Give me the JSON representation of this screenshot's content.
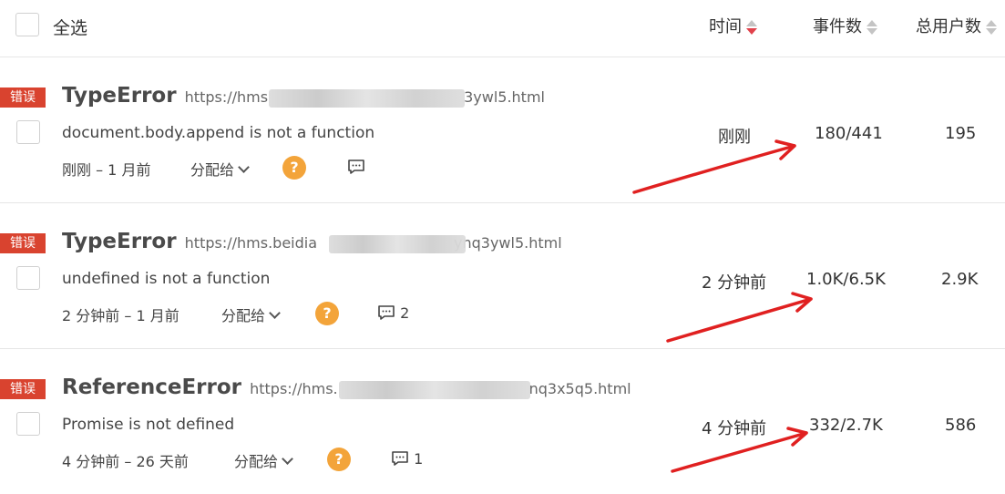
{
  "header": {
    "select_all_label": "全选",
    "col_time": "时间",
    "col_events": "事件数",
    "col_users": "总用户数"
  },
  "issues": [
    {
      "tag": "错误",
      "error_type": "TypeError",
      "url_visible_start": "https://hms",
      "url_visible_end": "3ywl5.html",
      "message": "document.body.append is not a function",
      "first_seen_range": "刚刚 – 1 月前",
      "assign_label": "分配给",
      "help_icon": "?",
      "comment_count": "",
      "time": "刚刚",
      "events": "180/441",
      "users": "195"
    },
    {
      "tag": "错误",
      "error_type": "TypeError",
      "url_visible_start": "https://hms.beidia",
      "url_visible_end": "ynq3ywl5.html",
      "message": "undefined is not a function",
      "first_seen_range": "2 分钟前 – 1 月前",
      "assign_label": "分配给",
      "help_icon": "?",
      "comment_count": "2",
      "time": "2 分钟前",
      "events": "1.0K/6.5K",
      "users": "2.9K"
    },
    {
      "tag": "错误",
      "error_type": "ReferenceError",
      "url_visible_start": "https://hms.",
      "url_visible_end": "nq3x5q5.html",
      "message": "Promise is not defined",
      "first_seen_range": "4 分钟前 – 26 天前",
      "assign_label": "分配给",
      "help_icon": "?",
      "comment_count": "1",
      "time": "4 分钟前",
      "events": "332/2.7K",
      "users": "586"
    }
  ],
  "colors": {
    "tag_red": "#d9432f",
    "help_orange": "#f3a43a",
    "annotation_arrow": "#e02020",
    "sort_active": "#e1414b"
  }
}
